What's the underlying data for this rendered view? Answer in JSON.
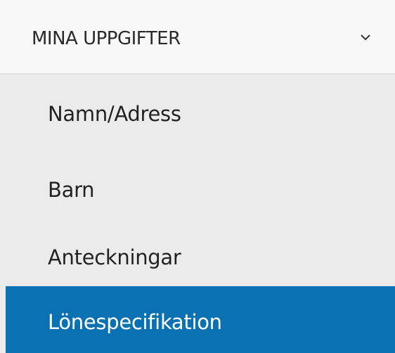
{
  "header": {
    "label": "MINA UPPGIFTER",
    "icon": "chevron-down-icon"
  },
  "items": [
    {
      "label": "Namn/Adress"
    },
    {
      "label": "Barn"
    },
    {
      "label": "Anteckningar"
    },
    {
      "label": "Lönespecifikation",
      "active": true
    }
  ],
  "colors": {
    "active_background": "#0a71b3",
    "active_text": "#ffffff",
    "item_background": "#ebebeb",
    "header_background": "#f8f8f8",
    "text": "#222222"
  }
}
